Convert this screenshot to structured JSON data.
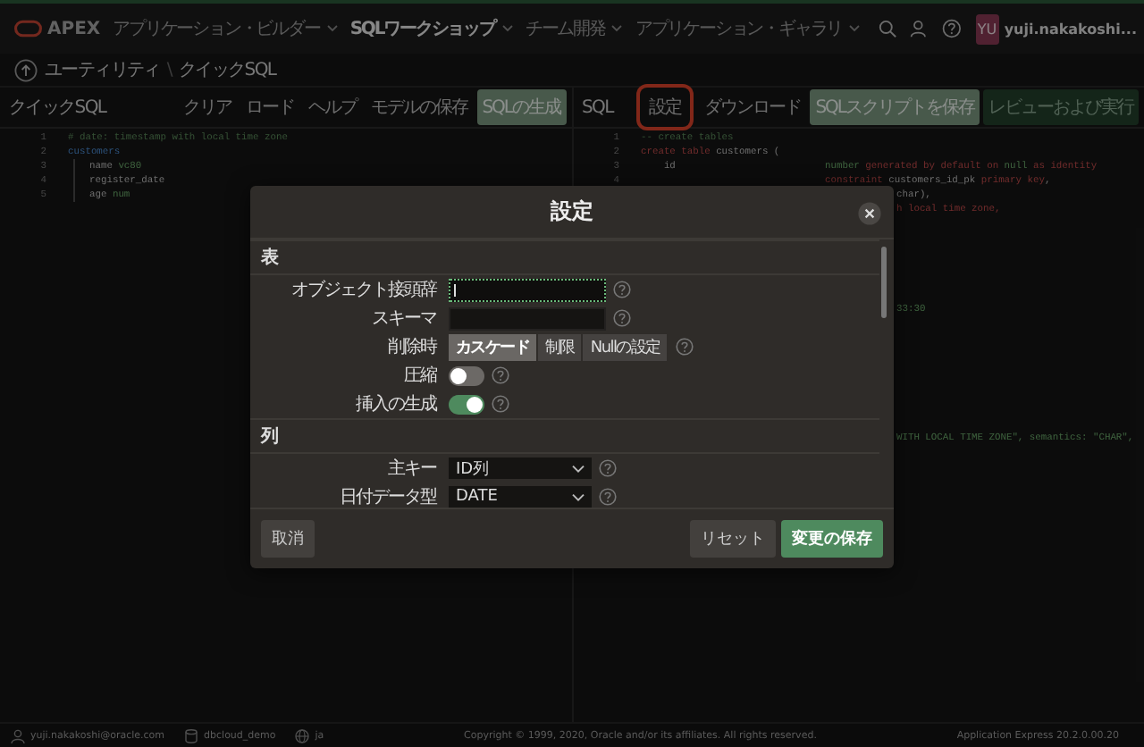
{
  "header": {
    "brand": "APEX",
    "nav": [
      {
        "label": "アプリケーション・ビルダー",
        "selected": false
      },
      {
        "label": "SQLワークショップ",
        "selected": true
      },
      {
        "label": "チーム開発",
        "selected": false
      },
      {
        "label": "アプリケーション・ギャラリ",
        "selected": false
      }
    ],
    "avatar": "YU",
    "user": "yuji.nakakoshi..."
  },
  "breadcrumb": {
    "items": [
      "ユーティリティ",
      "クイックSQL"
    ],
    "separator": "\\"
  },
  "left_pane": {
    "title": "クイックSQL",
    "buttons": [
      {
        "label": "クリア",
        "primary": false
      },
      {
        "label": "ロード",
        "primary": false
      },
      {
        "label": "ヘルプ",
        "primary": false
      },
      {
        "label": "モデルの保存",
        "primary": false
      },
      {
        "label": "SQLの生成",
        "primary": true
      }
    ],
    "lines": [
      {
        "num": "1",
        "indent": false,
        "tokens": [
          {
            "kind": "comment",
            "text": "# date: timestamp with local time zone"
          }
        ]
      },
      {
        "num": "2",
        "indent": false,
        "tokens": [
          {
            "kind": "table",
            "text": "customers"
          }
        ]
      },
      {
        "num": "3",
        "indent": true,
        "tokens": [
          {
            "kind": "plain",
            "text": "name "
          },
          {
            "kind": "type",
            "text": "vc80"
          }
        ]
      },
      {
        "num": "4",
        "indent": true,
        "tokens": [
          {
            "kind": "plain",
            "text": "register_date"
          }
        ]
      },
      {
        "num": "5",
        "indent": true,
        "tokens": [
          {
            "kind": "plain",
            "text": "age "
          },
          {
            "kind": "type",
            "text": "num"
          }
        ]
      }
    ]
  },
  "right_pane": {
    "title": "SQL",
    "buttons": [
      {
        "label": "設定",
        "kind": "plain",
        "highlighted": true
      },
      {
        "label": "ダウンロード",
        "kind": "plain",
        "highlighted": false
      },
      {
        "label": "SQLスクリプトを保存",
        "kind": "primary",
        "highlighted": false
      },
      {
        "label": "レビューおよび実行",
        "kind": "dim",
        "highlighted": false
      }
    ],
    "lines": [
      {
        "kind": "code",
        "num": "1",
        "tokens": [
          {
            "kind": "comment",
            "text": "-- create tables"
          }
        ]
      },
      {
        "kind": "code",
        "num": "2",
        "tokens": [
          {
            "kind": "keyword",
            "text": "create table"
          },
          {
            "kind": "plain",
            "text": " customers ("
          }
        ]
      },
      {
        "kind": "code",
        "num": "3",
        "tokens": [
          {
            "kind": "plain",
            "text": "    id"
          }
        ],
        "tail": [
          {
            "kind": "type",
            "text": "number"
          },
          {
            "kind": "keyword",
            "text": " generated by default on "
          },
          {
            "kind": "type",
            "text": "null"
          },
          {
            "kind": "keyword",
            "text": " as identity"
          }
        ]
      },
      {
        "kind": "code",
        "num": "4",
        "tail": [
          {
            "kind": "keyword",
            "text": "constraint"
          },
          {
            "kind": "plain",
            "text": " customers_id_pk "
          },
          {
            "kind": "keyword",
            "text": "primary key"
          },
          {
            "kind": "plain",
            "text": ","
          }
        ]
      },
      {
        "kind": "hidden",
        "tail": [
          {
            "kind": "plain",
            "text": "char),"
          }
        ]
      },
      {
        "kind": "hidden",
        "tail": [
          {
            "kind": "keyword",
            "text": "h local time zone,"
          }
        ]
      },
      {
        "kind": "blank"
      },
      {
        "kind": "blank"
      },
      {
        "kind": "blank"
      },
      {
        "kind": "blank"
      },
      {
        "kind": "blank"
      },
      {
        "kind": "blank"
      },
      {
        "kind": "hidden",
        "tail": [
          {
            "kind": "string",
            "text": "33:30"
          }
        ]
      },
      {
        "kind": "blank"
      },
      {
        "kind": "blank"
      },
      {
        "kind": "blank"
      },
      {
        "kind": "blank"
      },
      {
        "kind": "blank"
      },
      {
        "kind": "blank"
      },
      {
        "kind": "blank"
      },
      {
        "kind": "blank"
      },
      {
        "kind": "hidden",
        "tail": [
          {
            "kind": "string",
            "text": "WITH LOCAL TIME ZONE\", semantics: \"CHAR\","
          }
        ]
      }
    ]
  },
  "dialog": {
    "title": "設定",
    "sections": [
      {
        "title": "表",
        "fields": [
          {
            "kind": "text",
            "label": "オブジェクト接頭辞",
            "focused": true
          },
          {
            "kind": "text",
            "label": "スキーマ",
            "focused": false
          },
          {
            "kind": "segmented",
            "label": "削除時",
            "options": [
              {
                "label": "カスケード",
                "selected": true
              },
              {
                "label": "制限",
                "selected": false
              },
              {
                "label": "Nullの設定",
                "selected": false
              }
            ]
          },
          {
            "kind": "toggle",
            "label": "圧縮",
            "on": false
          },
          {
            "kind": "toggle",
            "label": "挿入の生成",
            "on": true
          }
        ]
      },
      {
        "title": "列",
        "fields": [
          {
            "kind": "select",
            "label": "主キー",
            "value": "ID列"
          },
          {
            "kind": "select",
            "label": "日付データ型",
            "value": "DATE"
          }
        ]
      }
    ],
    "cancel": "取消",
    "reset": "リセット",
    "save": "変更の保存"
  },
  "status_bar": {
    "user": "yuji.nakakoshi@oracle.com",
    "workspace": "dbcloud_demo",
    "language": "ja",
    "copyright": "Copyright © 1999, 2020, Oracle and/or its affiliates. All rights reserved.",
    "version": "Application Express 20.2.0.00.20"
  }
}
